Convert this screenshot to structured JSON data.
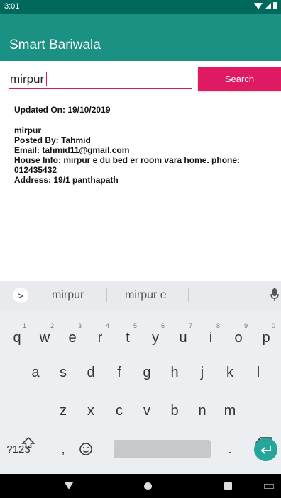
{
  "status_bar": {
    "time": "3:01"
  },
  "app_bar": {
    "title": "Smart Bariwala"
  },
  "search": {
    "value": "mirpur",
    "button_label": "Search"
  },
  "result": {
    "updated_on": "Updated On: 19/10/2019",
    "title": "mirpur",
    "posted_by": "Posted By: Tahmid",
    "email": "Email: tahmid11@gmail.com",
    "house_info": "House Info: mirpur e du bed er room vara home. phone: 012435432",
    "address": "Address: 19/1 panthapath"
  },
  "keyboard": {
    "suggestions": [
      "mirpur",
      "mirpur e"
    ],
    "row1": [
      {
        "key": "q",
        "hint": "1"
      },
      {
        "key": "w",
        "hint": "2"
      },
      {
        "key": "e",
        "hint": "3"
      },
      {
        "key": "r",
        "hint": "4"
      },
      {
        "key": "t",
        "hint": "5"
      },
      {
        "key": "y",
        "hint": "6"
      },
      {
        "key": "u",
        "hint": "7"
      },
      {
        "key": "i",
        "hint": "8"
      },
      {
        "key": "o",
        "hint": "9"
      },
      {
        "key": "p",
        "hint": "0"
      }
    ],
    "row2": [
      "a",
      "s",
      "d",
      "f",
      "g",
      "h",
      "j",
      "k",
      "l"
    ],
    "row3": [
      "z",
      "x",
      "c",
      "v",
      "b",
      "n",
      "m"
    ],
    "symbols_label": "?123",
    "comma": ",",
    "period": "."
  },
  "colors": {
    "status_bar": "#00695c",
    "app_bar": "#1a9182",
    "accent": "#e01a62",
    "enter_key": "#26a69a"
  },
  "icons": {
    "status": [
      "wifi-icon",
      "signal-icon",
      "battery-icon"
    ],
    "keyboard": [
      "chevron-right-icon",
      "mic-icon",
      "shift-icon",
      "backspace-icon",
      "emoji-icon",
      "enter-icon"
    ],
    "nav": [
      "back-icon",
      "home-icon",
      "recents-icon",
      "keyboard-switch-icon"
    ]
  }
}
